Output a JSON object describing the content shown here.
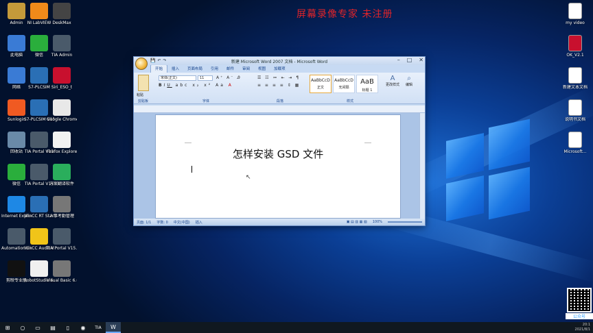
{
  "watermark": "屏幕录像专家 未注册",
  "colors": {
    "accent": "#e0242a",
    "ribbon": "#d1e0f5",
    "taskbar": "#101820"
  },
  "desktop_left": [
    {
      "label": "Admin",
      "color": "#c49a3a",
      "icon": "folder-user-icon"
    },
    {
      "label": "NI LabVIEW",
      "color": "#f08a1a",
      "icon": "labview-icon"
    },
    {
      "label": "DeskMax",
      "color": "#444",
      "icon": "app-icon"
    },
    {
      "label": "此电脑",
      "color": "#3a7bd5",
      "icon": "computer-icon"
    },
    {
      "label": "微信",
      "color": "#2aae3c",
      "icon": "wechat-icon"
    },
    {
      "label": "TIA Admin",
      "color": "#4a5a6a",
      "icon": "tia-admin-icon"
    },
    {
      "label": "网络",
      "color": "#3a7bd5",
      "icon": "network-icon"
    },
    {
      "label": "S7-PLCSIM",
      "color": "#2a6fb5",
      "icon": "plcsim-icon"
    },
    {
      "label": "Siri_ESO_t",
      "color": "#c8102e",
      "icon": "app-icon"
    },
    {
      "label": "Sunlogin",
      "color": "#f05a22",
      "icon": "sunlogin-icon"
    },
    {
      "label": "S7-PLCSIM V15.1",
      "color": "#2a6fb5",
      "icon": "plcsim-icon"
    },
    {
      "label": "Google Chrome",
      "color": "#e8e8e8",
      "icon": "chrome-icon"
    },
    {
      "label": "回收站",
      "color": "#6a8aa8",
      "icon": "recycle-bin-icon"
    },
    {
      "label": "TIA Portal V13",
      "color": "#4a5a6a",
      "icon": "tia-portal-icon"
    },
    {
      "label": "Firefox Explorer",
      "color": "#f2f2f2",
      "icon": "explorer-icon"
    },
    {
      "label": "微信",
      "color": "#2aae3c",
      "icon": "wechat-icon"
    },
    {
      "label": "TIA Portal V14",
      "color": "#4a5a6a",
      "icon": "tia-portal-icon"
    },
    {
      "label": "方案翻译软件",
      "color": "#2aae5c",
      "icon": "app-icon"
    },
    {
      "label": "Internet Explorer",
      "color": "#1e88e5",
      "icon": "ie-icon"
    },
    {
      "label": "WinCC RT Start",
      "color": "#2a6fb5",
      "icon": "wincc-icon"
    },
    {
      "label": "人事考勤管理",
      "color": "#777",
      "icon": "app-icon"
    },
    {
      "label": "Automation License M...",
      "color": "#4a5a6a",
      "icon": "license-icon"
    },
    {
      "label": "WinCC Audit Viewer",
      "color": "#f0c419",
      "icon": "wincc-audit-icon"
    },
    {
      "label": "TIA Portal V15.1",
      "color": "#4a5a6a",
      "icon": "tia-portal-icon"
    },
    {
      "label": "剪映专业版",
      "color": "#111",
      "icon": "capcut-icon"
    },
    {
      "label": "RobotStudio 6.07.01",
      "color": "#f0f0f0",
      "icon": "robotstudio-icon"
    },
    {
      "label": "Visual Basic 6.0中文版",
      "color": "#777",
      "icon": "vb-icon"
    }
  ],
  "desktop_right": [
    {
      "label": "my video",
      "color": "#fff",
      "icon": "file-icon"
    },
    {
      "label": "OK_V2.1",
      "color": "#c8102e",
      "icon": "file-icon"
    },
    {
      "label": "新建文本文档",
      "color": "#fff",
      "icon": "text-file-icon"
    },
    {
      "label": "说明书文档",
      "color": "#fff",
      "icon": "file-icon"
    },
    {
      "label": "Microsoft...",
      "color": "#fff",
      "icon": "excel-icon"
    }
  ],
  "word": {
    "title": "新建 Microsoft Word 2007 文档 - Microsoft Word",
    "tabs": [
      "开始",
      "插入",
      "页面布局",
      "引用",
      "邮件",
      "审阅",
      "视图",
      "加载项"
    ],
    "font_name": "宋体(正文)",
    "font_size": "11",
    "groups": [
      "剪贴板",
      "字体",
      "段落",
      "样式"
    ],
    "styles": [
      {
        "sample": "AaBbCcD",
        "name": "正文"
      },
      {
        "sample": "AaBbCcD",
        "name": "无间隔"
      },
      {
        "sample": "AaB",
        "name": "标题 1"
      }
    ],
    "change_styles": "更改样式",
    "edit": "编辑",
    "paste": "粘贴",
    "document_text": "怎样安装 GSD 文件",
    "status": {
      "page": "页面: 1/1",
      "words": "字数: 0",
      "lang": "中文(中国)",
      "mode": "插入",
      "zoom": "100%"
    }
  },
  "taskbar": {
    "time": "20:1",
    "date": "2021/8/1",
    "items": [
      "start-icon",
      "search-icon",
      "task-view-icon",
      "explorer-icon",
      "file-icon",
      "app-icon",
      "tia-icon",
      "word-icon"
    ]
  },
  "qr_caption": "公众号"
}
